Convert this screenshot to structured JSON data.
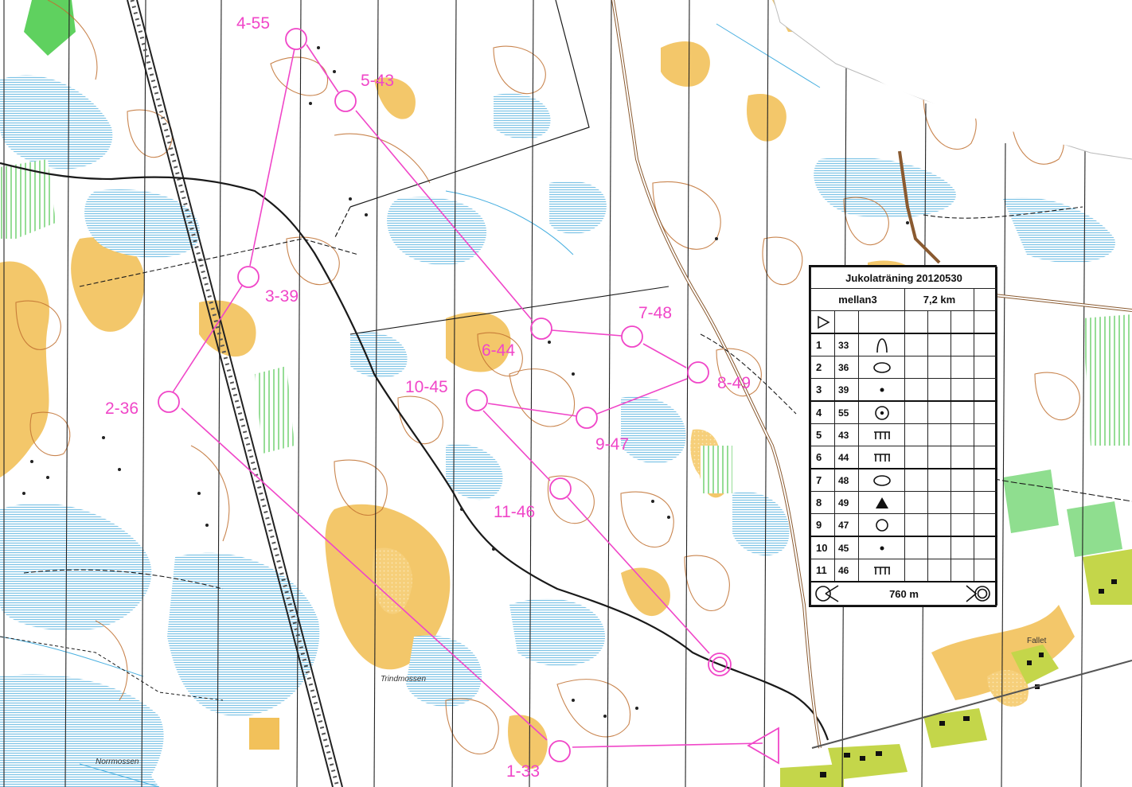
{
  "map": {
    "place_names": {
      "trindmossen": "Trindmossen",
      "norrmossen": "Norrmossen",
      "fallet": "Fallet"
    },
    "colors": {
      "course": "#f046c8",
      "open_land": "#f2c15a",
      "marsh": "#aad7ee",
      "contour": "#c07030",
      "vegetation": "#5fd15f",
      "settlement": "#c4d64a"
    },
    "controls": [
      {
        "label": "1-33"
      },
      {
        "label": "2-36"
      },
      {
        "label": "3-39"
      },
      {
        "label": "4-55"
      },
      {
        "label": "5-43"
      },
      {
        "label": "6-44"
      },
      {
        "label": "7-48"
      },
      {
        "label": "8-49"
      },
      {
        "label": "9-47"
      },
      {
        "label": "10-45"
      },
      {
        "label": "11-46"
      }
    ]
  },
  "description_sheet": {
    "title": "Jukolaträning 20120530",
    "course": "mellan3",
    "length": "7,2 km",
    "start_symbol": "start-triangle-icon",
    "rows": [
      {
        "num": "1",
        "code": "33",
        "symbol": "re-entrant-icon"
      },
      {
        "num": "2",
        "code": "36",
        "symbol": "knoll-oval-icon"
      },
      {
        "num": "3",
        "code": "39",
        "symbol": "small-knoll-dot-icon"
      },
      {
        "num": "4",
        "code": "55",
        "symbol": "depression-icon"
      },
      {
        "num": "5",
        "code": "43",
        "symbol": "rock-face-icon"
      },
      {
        "num": "6",
        "code": "44",
        "symbol": "rock-face-icon"
      },
      {
        "num": "7",
        "code": "48",
        "symbol": "knoll-oval-icon"
      },
      {
        "num": "8",
        "code": "49",
        "symbol": "boulder-icon"
      },
      {
        "num": "9",
        "code": "47",
        "symbol": "pit-icon"
      },
      {
        "num": "10",
        "code": "45",
        "symbol": "small-knoll-dot-icon"
      },
      {
        "num": "11",
        "code": "46",
        "symbol": "rock-face-icon"
      }
    ],
    "finish_distance": "760 m"
  }
}
